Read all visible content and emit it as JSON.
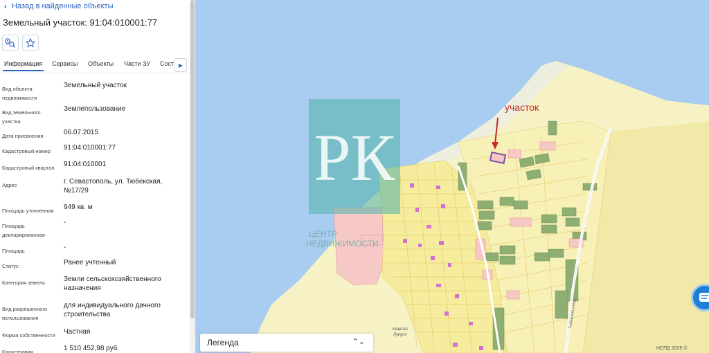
{
  "panel": {
    "back_label": "Назад в найденные объекты",
    "title": "Земельный участок: 91:04:010001:77",
    "tabs": [
      "Информация",
      "Сервисы",
      "Объекты",
      "Части ЗУ"
    ],
    "tab_clipped": "Состав",
    "rows": [
      {
        "label": "Вид объекта недвижимости",
        "value": "Земельный участок"
      },
      {
        "label": "Вид земельного участка",
        "value": "Землепользование"
      },
      {
        "label": "Дата присвоения",
        "value": "06.07.2015"
      },
      {
        "label": "Кадастровый номер",
        "value": "91:04:010001:77"
      },
      {
        "label": "Кадастровый квартал",
        "value": "91:04:010001"
      },
      {
        "label": "Адрес",
        "value": "г. Севастополь, ул. Тюбекская, №17/29"
      },
      {
        "label": "Площадь уточненная",
        "value": "949 кв. м"
      },
      {
        "label": "Площадь декларированная",
        "value": "-"
      },
      {
        "label": "Площадь",
        "value": "-"
      },
      {
        "label": "Статус",
        "value": "Ранее учтенный"
      },
      {
        "label": "Категория земель",
        "value": "Земли сельскохозяйственного назначения"
      },
      {
        "label": "Вид разрешенного использования",
        "value": "для индивидуального дачного строительства"
      },
      {
        "label": "Форма собственности",
        "value": "Частная"
      },
      {
        "label": "Кадастровая",
        "value": "1 510 452,98 руб."
      }
    ]
  },
  "map": {
    "annotation": "участок",
    "legend_label": "Легенда",
    "copyright": "НСПД 2025 ©",
    "watermark_letters": "РК",
    "watermark_text": [
      "ЦЕНТР",
      "НЕДВИЖИМОСТИ"
    ],
    "quarter_label": [
      "квартал",
      "Лукулл"
    ],
    "street_label": "Тюбекская улица",
    "colors": {
      "sea": "#a8cdf0",
      "land": "#f6f2c6",
      "parcel": "#f5ec9e",
      "green": "#8fae74",
      "pink": "#f6c9c6",
      "highlight": "#7b4fa8",
      "arrow": "#c62828",
      "watermark": "#4fb3a8"
    }
  }
}
